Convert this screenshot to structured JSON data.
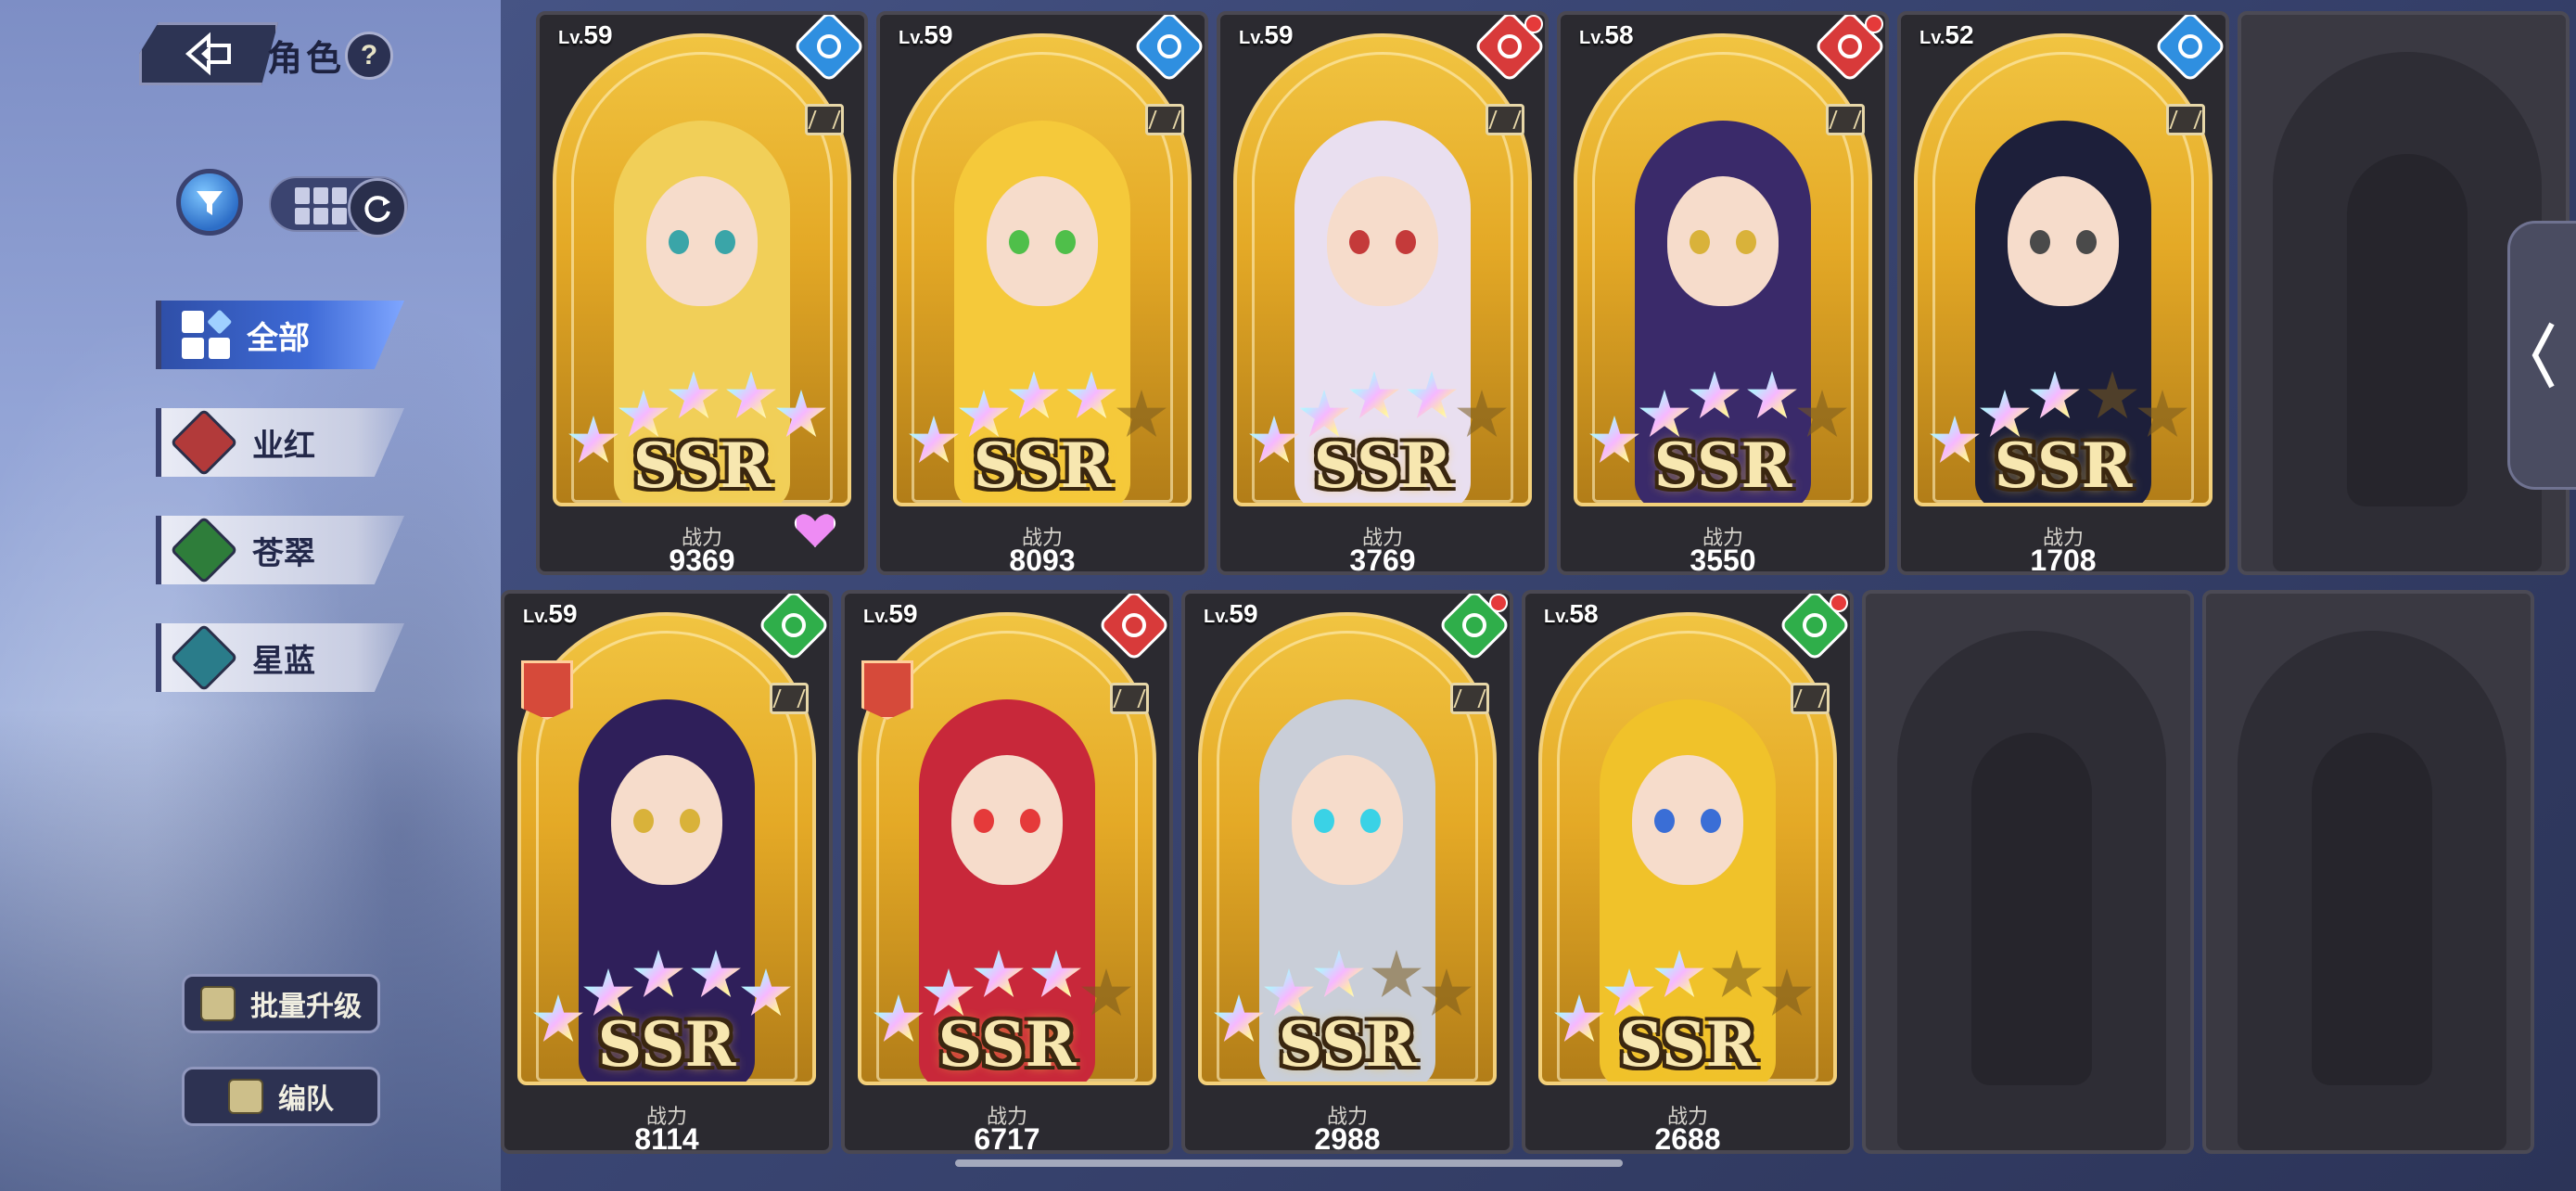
{
  "header": {
    "title": "角色",
    "help": "?"
  },
  "filters": {
    "tabs": [
      {
        "label": "全部",
        "active": true
      },
      {
        "label": "业红",
        "color": "#b23a3a"
      },
      {
        "label": "苍翠",
        "color": "#2e7d3a"
      },
      {
        "label": "星蓝",
        "color": "#2a7c8a"
      }
    ]
  },
  "actions": {
    "bulk_upgrade": "批量升级",
    "team": "编队"
  },
  "cards": [
    {
      "level_prefix": "Lv.",
      "level": "59",
      "power_label": "战力",
      "power": "9369",
      "rarity": "SSR",
      "stars": 5,
      "class_color": "#2f8fe0",
      "class_icon": "mage-icon",
      "favorite": true,
      "red_dot": false,
      "hair": "#f1cf58",
      "eye": "#3aa5a8"
    },
    {
      "level_prefix": "Lv.",
      "level": "59",
      "power_label": "战力",
      "power": "8093",
      "rarity": "SSR",
      "stars": 4,
      "class_color": "#2f8fe0",
      "class_icon": "sword-icon",
      "favorite": false,
      "red_dot": false,
      "hair": "#f5c93a",
      "eye": "#4fbf4a"
    },
    {
      "level_prefix": "Lv.",
      "level": "59",
      "power_label": "战力",
      "power": "3769",
      "rarity": "SSR",
      "stars": 4,
      "class_color": "#d83a3a",
      "class_icon": "sword-icon",
      "favorite": false,
      "red_dot": true,
      "hair": "#e9dff0",
      "eye": "#c43a3a"
    },
    {
      "level_prefix": "Lv.",
      "level": "58",
      "power_label": "战力",
      "power": "3550",
      "rarity": "SSR",
      "stars": 4,
      "class_color": "#d83a3a",
      "class_icon": "dagger-icon",
      "favorite": false,
      "red_dot": true,
      "hair": "#3a2a6a",
      "eye": "#d9b23a"
    },
    {
      "level_prefix": "Lv.",
      "level": "52",
      "power_label": "战力",
      "power": "1708",
      "rarity": "SSR",
      "stars": 3,
      "class_color": "#2f8fe0",
      "class_icon": "dagger-icon",
      "favorite": false,
      "red_dot": false,
      "hair": "#1d1f3a",
      "eye": "#4a4a4a"
    },
    {
      "level_prefix": "Lv.",
      "level": "59",
      "power_label": "战力",
      "power": "8114",
      "rarity": "SSR",
      "stars": 5,
      "class_color": "#2fae4a",
      "class_icon": "flame-icon",
      "favorite": false,
      "red_dot": false,
      "role": true,
      "hair": "#2f1f5a",
      "eye": "#d9b23a"
    },
    {
      "level_prefix": "Lv.",
      "level": "59",
      "power_label": "战力",
      "power": "6717",
      "rarity": "SSR",
      "stars": 4,
      "class_color": "#d83a3a",
      "class_icon": "shield-icon",
      "favorite": false,
      "red_dot": false,
      "role": true,
      "hair": "#c8283a",
      "eye": "#e53a3a"
    },
    {
      "level_prefix": "Lv.",
      "level": "59",
      "power_label": "战力",
      "power": "2988",
      "rarity": "SSR",
      "stars": 3,
      "class_color": "#2fae4a",
      "class_icon": "shield-icon",
      "favorite": false,
      "red_dot": true,
      "hair": "#c9ced8",
      "eye": "#3ad2e6"
    },
    {
      "level_prefix": "Lv.",
      "level": "58",
      "power_label": "战力",
      "power": "2688",
      "rarity": "SSR",
      "stars": 3,
      "class_color": "#2fae4a",
      "class_icon": "flame-icon",
      "favorite": false,
      "red_dot": true,
      "hair": "#f0c22a",
      "eye": "#3a6ed6"
    }
  ]
}
